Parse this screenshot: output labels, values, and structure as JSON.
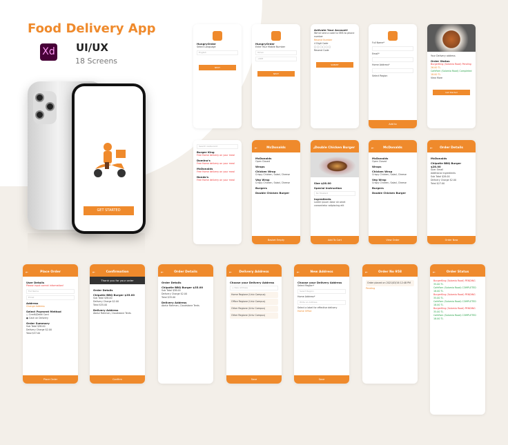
{
  "hero": {
    "title": "Food Delivery App",
    "tool": "Xd",
    "subtitle": "UI/UX",
    "count": "18 Screens",
    "cta": "GET STARTED"
  },
  "colors": {
    "accent": "#ef8a2c",
    "bg": "#f3efe9"
  },
  "screens": [
    {
      "id": "select-language",
      "lines": [
        {
          "t": "HungryOrder",
          "c": "h"
        },
        {
          "t": "Select Language"
        },
        {
          "t": "English",
          "c": "inp"
        }
      ],
      "logo": true,
      "button": "NEXT"
    },
    {
      "id": "mobile-number",
      "lines": [
        {
          "t": "HungryOrder",
          "c": "h"
        },
        {
          "t": "Enter Your Mobile Number"
        },
        {
          "t": "Oman",
          "c": "inp"
        },
        {
          "t": "+968",
          "c": "inp"
        }
      ],
      "logo": true,
      "button": "NEXT"
    },
    {
      "id": "activate-account",
      "lines": [
        {
          "t": "Activate Your Account!",
          "c": "h"
        },
        {
          "t": "We've sent a code to SMS to phone number"
        },
        {
          "t": "Resend Number",
          "c": "o"
        },
        {
          "t": "4 Digit Code"
        },
        {
          "t": "□ □ □ □ □ □"
        },
        {
          "t": "Resend Code"
        }
      ],
      "button": "SUBMIT"
    },
    {
      "id": "register",
      "lines": [
        {
          "t": "Full Name*"
        },
        {
          "t": "",
          "c": "inp"
        },
        {
          "t": "Email*"
        },
        {
          "t": "",
          "c": "inp"
        },
        {
          "t": "Home Address*"
        },
        {
          "t": "",
          "c": "inp"
        },
        {
          "t": "Select Region"
        }
      ],
      "logo": true,
      "bar": "Add to"
    },
    {
      "id": "track-orders",
      "image": "food",
      "lines": [
        {
          "t": "Your Delivery address"
        },
        {
          "t": "Order Status",
          "c": "h"
        },
        {
          "t": "BurgerKing (Salamia Road)  Pending",
          "c": "r"
        },
        {
          "t": "26.00 TL",
          "c": "o"
        },
        {
          "t": "CafeFam (Salamia Road)  Completed",
          "c": "g"
        },
        {
          "t": "18.00 TL",
          "c": "o"
        },
        {
          "t": "View More"
        }
      ],
      "button": "Get Started"
    },
    {
      "id": "restaurants",
      "lines": [
        {
          "t": "Search restaurant",
          "c": "inp"
        },
        {
          "t": "Burger King",
          "c": "h"
        },
        {
          "t": "Free Home delivery on your meal",
          "c": "r"
        },
        {
          "t": "Domino's",
          "c": "h"
        },
        {
          "t": "Free Home delivery on your meal",
          "c": "r"
        },
        {
          "t": "McDonalds",
          "c": "h"
        },
        {
          "t": "Free Home delivery on your meal",
          "c": "r"
        },
        {
          "t": "Nando's",
          "c": "h"
        },
        {
          "t": "Free Home delivery on your meal",
          "c": "r"
        }
      ]
    },
    {
      "id": "menu",
      "header": "McDonalds",
      "lines": [
        {
          "t": "McDonalds",
          "c": "h"
        },
        {
          "t": "Open  Closed"
        },
        {
          "t": "Wraps",
          "c": "h"
        },
        {
          "t": "Chicken Wrap",
          "c": "h"
        },
        {
          "t": "Crispy Chicken, Salad, Cheese"
        },
        {
          "t": "Veg Wrap",
          "c": "h"
        },
        {
          "t": "Crispy Chicken, Salad, Cheese"
        },
        {
          "t": "Burgers",
          "c": "h"
        },
        {
          "t": "Double Chicken Burger",
          "c": "h"
        }
      ],
      "bar": "Basket Empty"
    },
    {
      "id": "product",
      "header": "Double Chicken Burger",
      "image": "burger",
      "lines": [
        {
          "t": "Size  $28.00",
          "c": "h"
        },
        {
          "t": "Special Instruction",
          "c": "h"
        },
        {
          "t": "No Mustard",
          "c": "inp"
        },
        {
          "t": "Ingredients",
          "c": "h"
        },
        {
          "t": "Lorem ipsum dolor sit amet consectetur adipiscing elit"
        }
      ],
      "bar": "Add To Cart"
    },
    {
      "id": "menu-basket",
      "header": "McDonalds",
      "lines": [
        {
          "t": "McDonalds",
          "c": "h"
        },
        {
          "t": "Open  Closed"
        },
        {
          "t": "Wraps",
          "c": "h"
        },
        {
          "t": "Chicken Wrap",
          "c": "h"
        },
        {
          "t": "Crispy Chicken, Salad, Cheese"
        },
        {
          "t": "Veg Wrap",
          "c": "h"
        },
        {
          "t": "Crispy Chicken, Salad, Cheese"
        },
        {
          "t": "Burgers",
          "c": "h"
        },
        {
          "t": "Double Chicken Burger",
          "c": "h"
        }
      ],
      "bar": "View Order"
    },
    {
      "id": "order-details-1",
      "header": "Order Details",
      "lines": [
        {
          "t": "McDonalds",
          "c": "h"
        },
        {
          "t": "Chipotle BBQ Burger   $28.00",
          "c": "h"
        },
        {
          "t": "Size: Small"
        },
        {
          "t": "Additional ingredients"
        },
        {
          "t": "Sub Total   $28.00"
        },
        {
          "t": "Delivery Charge   $2.00"
        },
        {
          "t": "Total   $27.00"
        }
      ],
      "bar": "Order Now"
    },
    {
      "id": "place-order",
      "header": "Place Order",
      "lines": [
        {
          "t": "User Details",
          "c": "h"
        },
        {
          "t": "Please input correct information!",
          "c": "r"
        },
        {
          "t": "Full Name",
          "c": "inp"
        },
        {
          "t": "Email",
          "c": "inp"
        },
        {
          "t": "Address",
          "c": "h"
        },
        {
          "t": "Change Address",
          "c": "o"
        },
        {
          "t": "Select Payment Method",
          "c": "h"
        },
        {
          "t": "○ Credit/Debit Card"
        },
        {
          "t": "● Cash on Delivery"
        },
        {
          "t": "Order Summary",
          "c": "h"
        },
        {
          "t": "Sub Total   $38.00"
        },
        {
          "t": "Delivery Charge   $2.00"
        },
        {
          "t": "Total   $37.00"
        }
      ],
      "bar": "Place Order"
    },
    {
      "id": "confirmation",
      "header": "Confirmation",
      "banner": "Thank you for your order",
      "lines": [
        {
          "t": "Order Details",
          "c": "h"
        },
        {
          "t": "Chipotle BBQ Burger   $35.00",
          "c": "h"
        },
        {
          "t": "Sub Total   $38.00"
        },
        {
          "t": "Delivery Charge   $2.00"
        },
        {
          "t": "Total   $35.00"
        },
        {
          "t": "Delivery Address",
          "c": "h"
        },
        {
          "t": "Abdur Rahman, Cloudstone Tents"
        }
      ],
      "bar": "Confirm"
    },
    {
      "id": "order-details-2",
      "header": "Order Details",
      "lines": [
        {
          "t": "Order Details",
          "c": "h"
        },
        {
          "t": "Chipotle BBQ Burger   $35.00",
          "c": "h"
        },
        {
          "t": "Sub Total   $38.00"
        },
        {
          "t": "Delivery Charge   $2.00"
        },
        {
          "t": "Total   $35.00"
        },
        {
          "t": "Delivery Address",
          "c": "h"
        },
        {
          "t": "Abdur Rahman, Cloudstone Tents"
        }
      ]
    },
    {
      "id": "delivery-address-1",
      "header": "Delivery Address",
      "lines": [
        {
          "t": "Choose your Delivery Address",
          "c": "h"
        },
        {
          "t": "+ New Address",
          "c": "inp"
        },
        {
          "t": "Home  Regione (Univ Campus)",
          "c": "box"
        },
        {
          "t": "Office  Regione (Univ Campus)",
          "c": "box"
        },
        {
          "t": "Other  Regione (Univ Campus)",
          "c": "box"
        },
        {
          "t": "Other  Regione (Univ Campus)",
          "c": "box"
        }
      ],
      "bar": "Save"
    },
    {
      "id": "new-address",
      "header": "New Address",
      "lines": [
        {
          "t": "Choose your Delivery Address",
          "c": "h"
        },
        {
          "t": "Select Region*"
        },
        {
          "t": "Select Region",
          "c": "inp"
        },
        {
          "t": "Home Address*"
        },
        {
          "t": "Write an Address",
          "c": "inp"
        },
        {
          "t": "Select a label for effective delivery"
        },
        {
          "t": "Home  Office",
          "c": "o"
        }
      ],
      "bar": "Save"
    },
    {
      "id": "order-placed",
      "header": "Order No 958",
      "lines": [
        {
          "t": ""
        },
        {
          "t": ""
        },
        {
          "t": ""
        },
        {
          "t": "Order placed on 2021/03/16 12:48 PM",
          "c": "box"
        },
        {
          "t": "Pending",
          "c": "o"
        }
      ]
    },
    {
      "id": "order-status",
      "header": "Order Status",
      "lines": [
        {
          "t": "BurgerKing (Salamia Road)  PENDING",
          "c": "r"
        },
        {
          "t": "35.00 TL",
          "c": "g"
        },
        {
          "t": "CafeFam (Salamia Road)  COMPLETED",
          "c": "g"
        },
        {
          "t": "18.00 TL",
          "c": "g"
        },
        {
          "t": "BurgerKing (Salamia Road)  PENDING",
          "c": "r"
        },
        {
          "t": "35.00 TL",
          "c": "g"
        },
        {
          "t": "CafeFam (Salamia Road)  COMPLETED",
          "c": "g"
        },
        {
          "t": "18.00 TL",
          "c": "g"
        },
        {
          "t": "BurgerKing (Salamia Road)  PENDING",
          "c": "r"
        },
        {
          "t": "35.00 TL",
          "c": "g"
        },
        {
          "t": "CafeFam (Salamia Road)  COMPLETED",
          "c": "g"
        },
        {
          "t": "18.00 TL",
          "c": "g"
        }
      ]
    }
  ]
}
